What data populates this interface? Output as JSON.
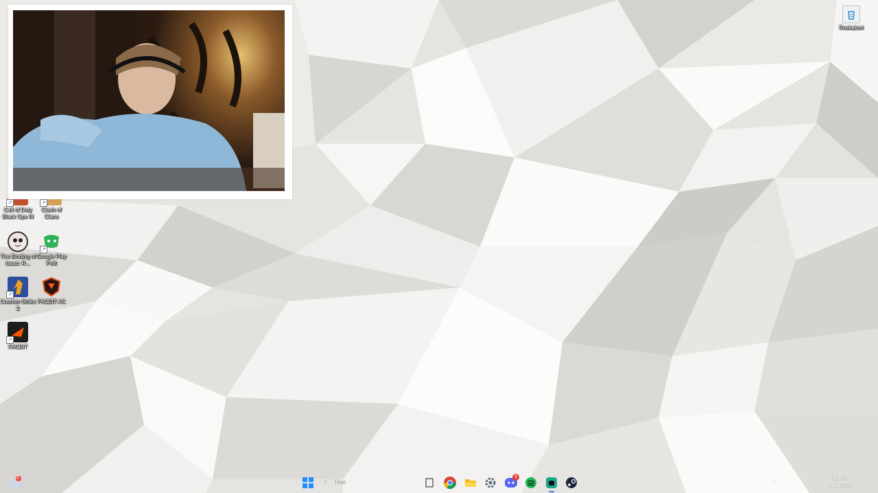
{
  "desktop": {
    "recycle_bin_label": "Roskakori",
    "icons": [
      {
        "label": "Call of Duty Black Ops III",
        "icon": "call-of-duty-icon"
      },
      {
        "label": "Clash of Clans",
        "icon": "clash-of-clans-icon"
      },
      {
        "label": "The Binding of Isaac: R...",
        "icon": "binding-of-isaac-icon"
      },
      {
        "label": "Google Play Pelit",
        "icon": "google-play-games-icon"
      },
      {
        "label": "Counter-Strike 2",
        "icon": "counter-strike-icon"
      },
      {
        "label": "FACEIT AC",
        "icon": "faceit-ac-icon"
      },
      {
        "label": "FACEIT",
        "icon": "faceit-icon"
      }
    ]
  },
  "taskbar": {
    "search_placeholder": "Hae",
    "discord_badge": "9",
    "widget_badge": "1",
    "clock": "13.24",
    "date": "6.2.2025",
    "apps": [
      "Chrome",
      "File Explorer",
      "Settings",
      "Discord",
      "Spotify",
      "Chatbot",
      "Steam"
    ],
    "colors": {
      "windows": "#1e90ff",
      "chrome": "#4285f4",
      "explorer": "#f2b90f",
      "discord": "#5865f2",
      "spotify": "#1db954",
      "steam": "#1b2838"
    }
  }
}
